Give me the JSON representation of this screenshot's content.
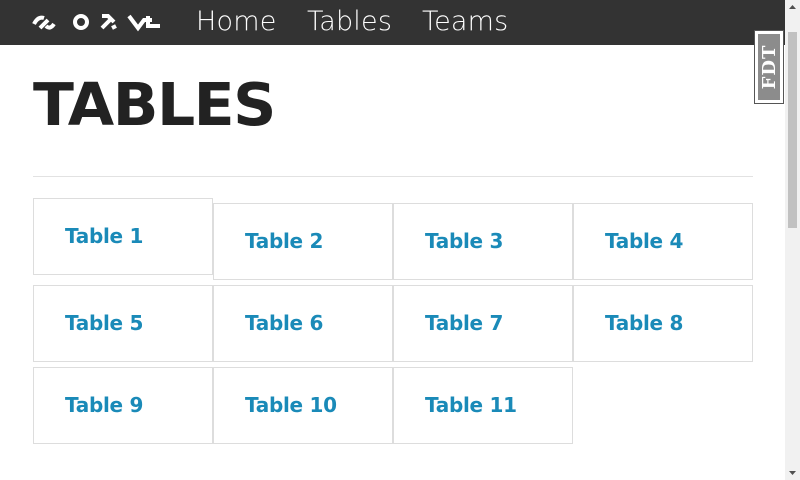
{
  "navbar": {
    "links": [
      {
        "label": "Home"
      },
      {
        "label": "Tables"
      },
      {
        "label": "Teams"
      }
    ]
  },
  "page": {
    "title": "TABLES"
  },
  "tables": [
    {
      "label": "Table 1"
    },
    {
      "label": "Table 2"
    },
    {
      "label": "Table 3"
    },
    {
      "label": "Table 4"
    },
    {
      "label": "Table 5"
    },
    {
      "label": "Table 6"
    },
    {
      "label": "Table 7"
    },
    {
      "label": "Table 8"
    },
    {
      "label": "Table 9"
    },
    {
      "label": "Table 10"
    },
    {
      "label": "Table 11"
    }
  ],
  "badge": {
    "text": "FDT"
  },
  "colors": {
    "navbar_bg": "#333333",
    "link": "#1a8ab8",
    "title": "#222222",
    "tile_border": "#dddddd"
  },
  "icons": {
    "logo": "brand-logo-icon",
    "scroll_up": "scroll-up-arrow-icon",
    "scroll_down": "scroll-down-arrow-icon"
  }
}
